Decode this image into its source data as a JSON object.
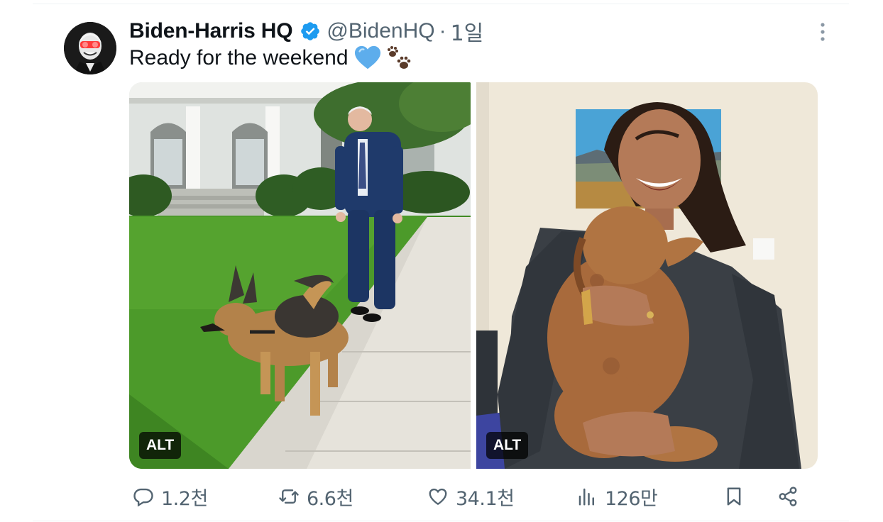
{
  "tweet": {
    "display_name": "Biden-Harris HQ",
    "handle": "@BidenHQ",
    "separator": "·",
    "time": "1일",
    "text": "Ready for the weekend",
    "emojis": [
      "blue-heart",
      "paw-prints"
    ]
  },
  "media": [
    {
      "alt_label": "ALT",
      "subject": "man walking a German Shepherd on a lawn"
    },
    {
      "alt_label": "ALT",
      "subject": "woman laughing holding a fluffy puppy"
    }
  ],
  "actions": {
    "replies": "1.2천",
    "reposts": "6.6천",
    "likes": "34.1천",
    "views": "126만"
  },
  "colors": {
    "text_primary": "#0f1419",
    "text_secondary": "#536471",
    "verified_blue": "#1d9bf0",
    "divider": "#eff3f4"
  },
  "icons": [
    "verified-badge-icon",
    "more-icon",
    "reply-icon",
    "repost-icon",
    "like-icon",
    "views-icon",
    "bookmark-icon",
    "share-icon"
  ]
}
